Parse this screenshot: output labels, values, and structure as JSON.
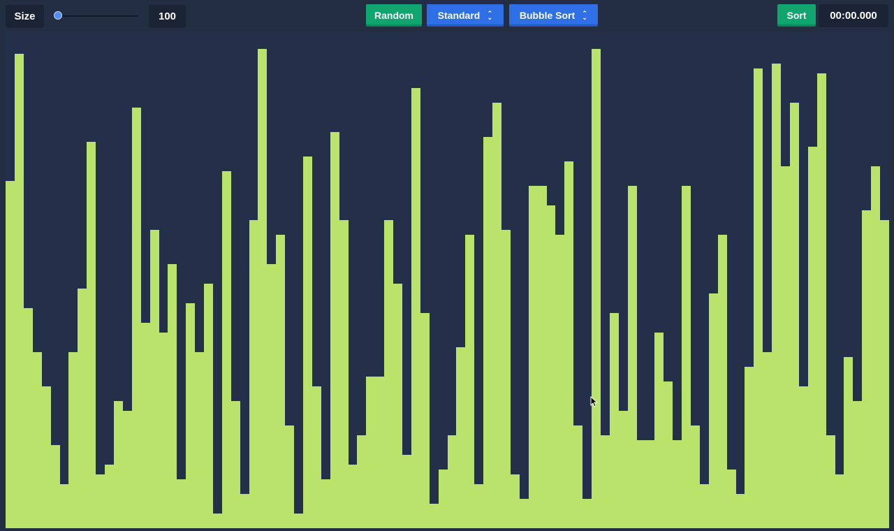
{
  "controls": {
    "size_label": "Size",
    "size_value": "100",
    "slider_fraction": 0.0,
    "random_label": "Random",
    "mode_label": "Standard",
    "algorithm_label": "Bubble Sort",
    "sort_label": "Sort",
    "timer": "00:00.000"
  },
  "icons": {
    "select_chevrons": "chevron-up-down-icon",
    "cursor": "mouse-pointer-icon"
  },
  "colors": {
    "background": "#232e42",
    "bar": "#b9e36b",
    "green_button": "#10a46e",
    "blue_button": "#2f6fe6",
    "slider_thumb": "#4f8ef7"
  },
  "visualizer": {
    "bar_values": [
      71,
      97,
      45,
      36,
      29,
      17,
      9,
      36,
      49,
      79,
      11,
      13,
      26,
      24,
      86,
      42,
      61,
      40,
      54,
      10,
      46,
      36,
      50,
      3,
      73,
      26,
      7,
      63,
      98,
      54,
      60,
      21,
      3,
      76,
      29,
      10,
      81,
      63,
      13,
      19,
      31,
      31,
      63,
      50,
      15,
      90,
      44,
      5,
      12,
      19,
      37,
      60,
      9,
      80,
      87,
      61,
      11,
      6,
      70,
      70,
      66,
      60,
      75,
      21,
      6,
      98,
      19,
      44,
      24,
      70,
      18,
      18,
      40,
      30,
      18,
      70,
      21,
      9,
      48,
      60,
      12,
      7,
      33,
      94,
      36,
      95,
      74,
      87,
      29,
      78,
      93,
      19,
      11,
      35,
      26,
      65,
      74,
      63
    ]
  }
}
